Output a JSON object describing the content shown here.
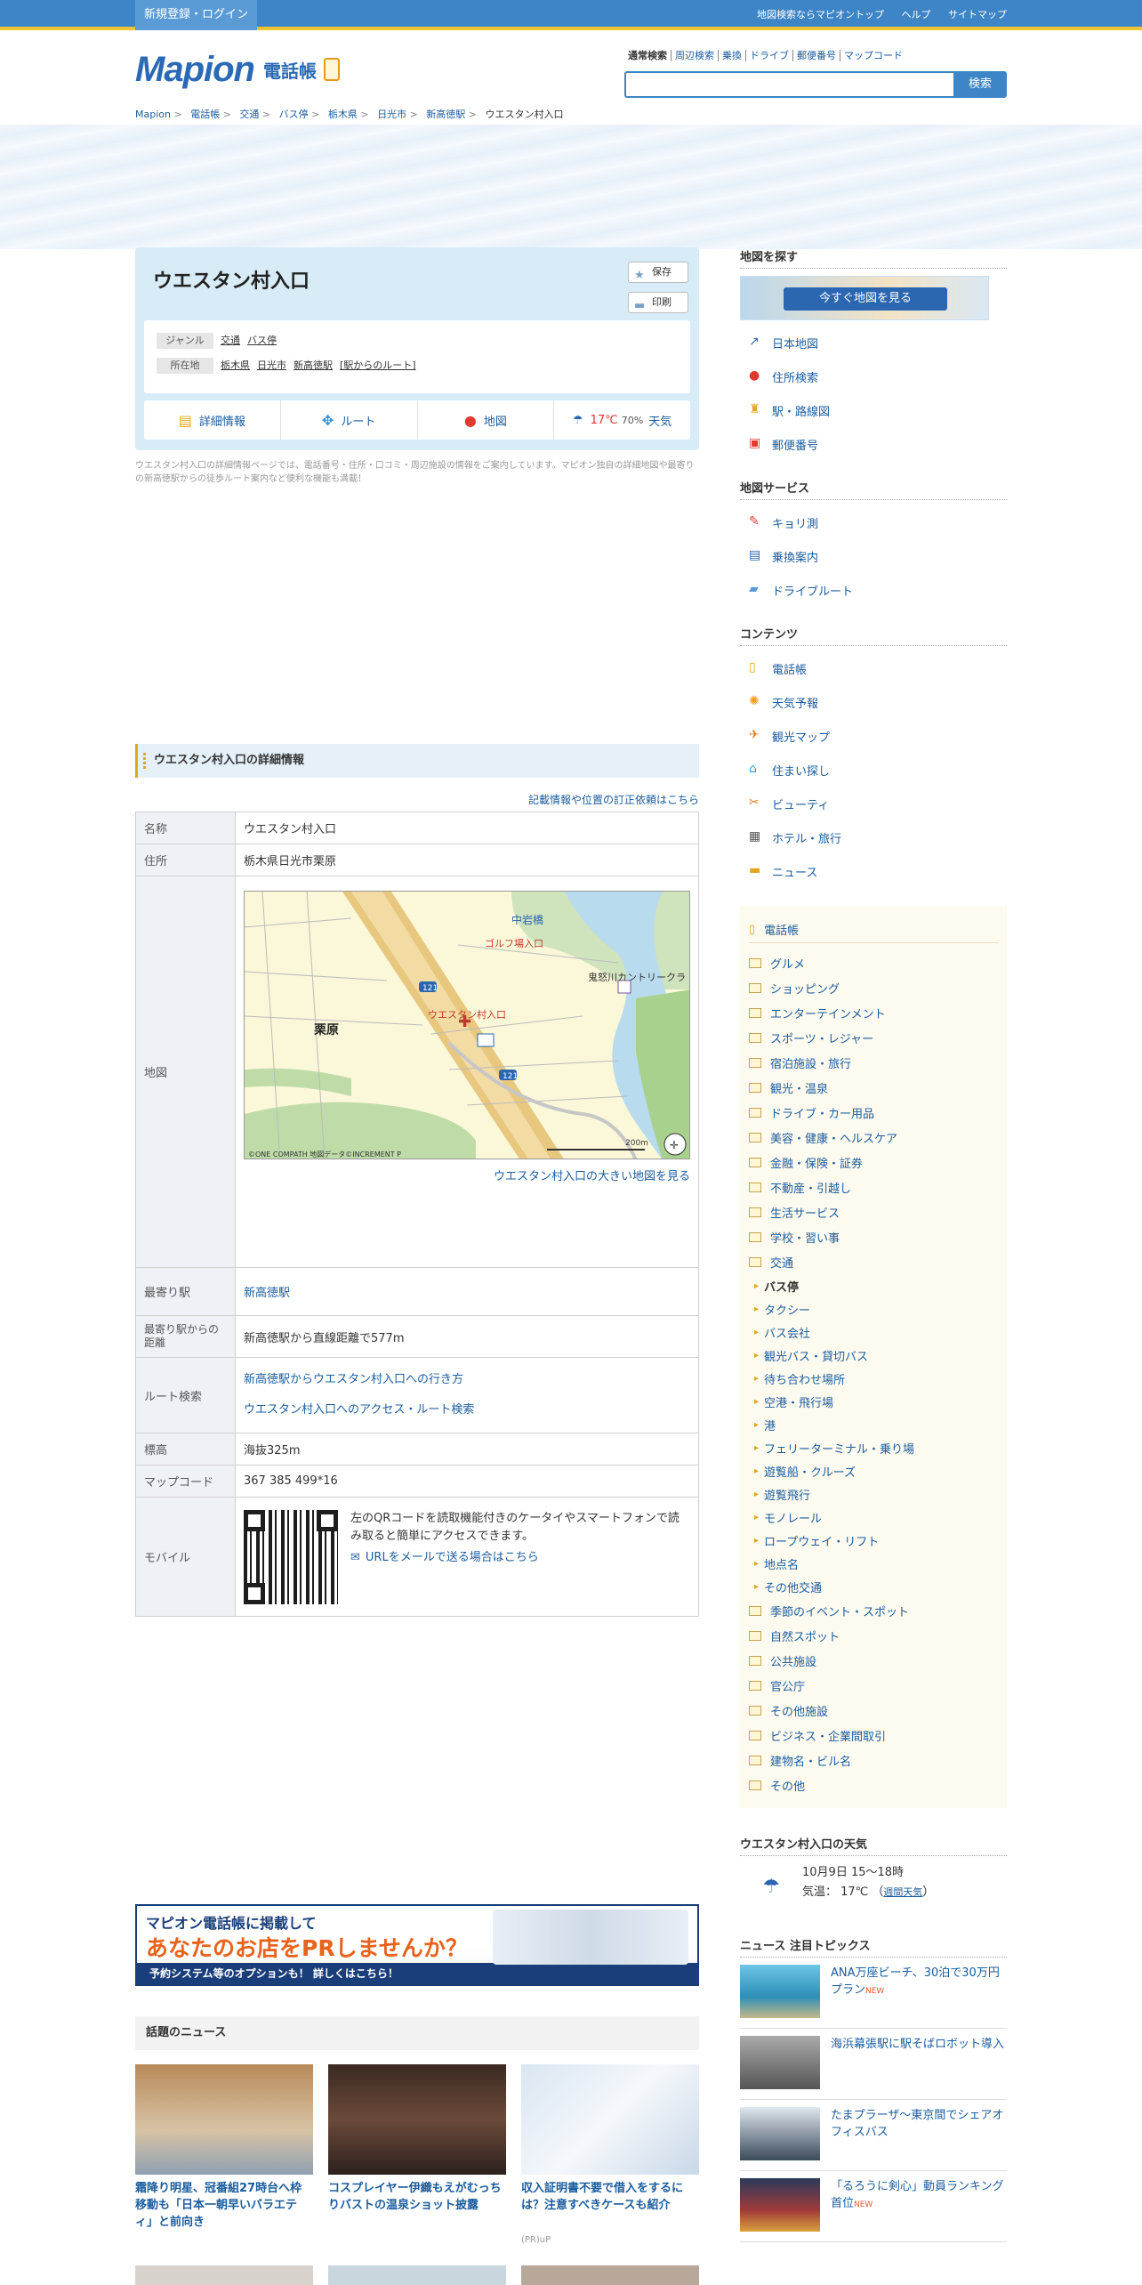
{
  "topbar": {
    "login": "新規登録・ログイン",
    "links": [
      "地図検索ならマピオントップ",
      "ヘルプ",
      "サイトマップ"
    ]
  },
  "logo": {
    "brand": "Mapion",
    "sub": "電話帳"
  },
  "search": {
    "tabs": [
      "通常検索",
      "周辺検索",
      "乗換",
      "ドライブ",
      "郵便番号",
      "マップコード"
    ],
    "button": "検索",
    "value": ""
  },
  "breadcrumb": [
    "Mapion",
    "電話帳",
    "交通",
    "バス停",
    "栃木県",
    "日光市",
    "新高徳駅",
    "ウエスタン村入口"
  ],
  "place": {
    "title": "ウエスタン村入口",
    "save": "保存",
    "print": "印刷",
    "genre_label": "ジャンル",
    "genre": [
      "交通",
      "バス停"
    ],
    "address_label": "所在地",
    "address_links": [
      "栃木県",
      "日光市",
      "新高徳駅",
      "[駅からのルート]"
    ],
    "menu": [
      "詳細情報",
      "ルート",
      "地図",
      "17℃",
      "70%",
      "天気"
    ],
    "description": "ウエスタン村入口の詳細情報ページでは、電話番号・住所・口コミ・周辺施設の情報をご案内しています。マピオン独自の詳細地図や最寄りの新高徳駅からの徒歩ルート案内など便利な機能も満載！"
  },
  "details": {
    "heading": "ウエスタン村入口の詳細情報",
    "correction_link": "記載情報や位置の訂正依頼はこちら",
    "rows": {
      "name_label": "名称",
      "name": "ウエスタン村入口",
      "address_label": "住所",
      "address": "栃木県日光市栗原",
      "map_label": "地図",
      "map_link": "ウエスタン村入口の大きい地図を見る",
      "station_label": "最寄り駅",
      "station": "新高徳駅",
      "distance_label": "最寄り駅からの距離",
      "distance": "新高徳駅から直線距離で577m",
      "route_label": "ルート検索",
      "route_links": [
        "新高徳駅からウエスタン村入口への行き方",
        "ウエスタン村入口へのアクセス・ルート検索"
      ],
      "altitude_label": "標高",
      "altitude": "海抜325m",
      "mapcode_label": "マップコード",
      "mapcode": "367 385 499*16",
      "mobile_label": "モバイル",
      "mobile_text": "左のQRコードを読取機能付きのケータイやスマートフォンで読み取ると簡単にアクセスできます。",
      "mobile_link": "URLをメールで送る場合はこちら"
    },
    "map": {
      "labels": [
        "中岩橋",
        "ゴルフ場入口",
        "鬼怒川カントリークラ",
        "栗原",
        "ウエスタン村入口",
        "121",
        "121"
      ],
      "scale": "200m",
      "copyright": "©ONE COMPATH 地図データ©INCREMENT P"
    }
  },
  "banner": {
    "line1": "マピオン電話帳に掲載して",
    "line2": "あなたのお店をPRしませんか？",
    "line3": "予約システム等のオプションも！ 詳しくはこちら！"
  },
  "news": {
    "heading": "話題のニュース",
    "items": [
      "霜降り明星、冠番組27時台へ枠移動も「日本一朝早いバラエティ」と前向き",
      "コスプレイヤー伊織もえがむっちりバストの温泉ショット披露",
      "収入証明書不要で借入をするには？注意すべきケースも紹介"
    ],
    "pr": "(PR)uP"
  },
  "sidebar": {
    "find_map": "地図を探す",
    "map_button": "今すぐ地図を見る",
    "find_links": [
      "日本地図",
      "住所検索",
      "駅・路線図",
      "郵便番号"
    ],
    "services_head": "地図サービス",
    "services": [
      "キョリ測",
      "乗換案内",
      "ドライブルート"
    ],
    "contents_head": "コンテンツ",
    "contents": [
      "電話帳",
      "天気予報",
      "観光マップ",
      "住まい探し",
      "ビューティ",
      "ホテル・旅行",
      "ニュース"
    ],
    "phonebook_head": "電話帳",
    "categories_top": [
      "グルメ",
      "ショッピング",
      "エンターテインメント",
      "スポーツ・レジャー",
      "宿泊施設・旅行",
      "観光・温泉",
      "ドライブ・カー用品",
      "美容・健康・ヘルスケア",
      "金融・保険・証券",
      "不動産・引越し",
      "生活サービス",
      "学校・習い事",
      "交通"
    ],
    "categories_sub": [
      "バス停",
      "タクシー",
      "バス会社",
      "観光バス・貸切バス",
      "待ち合わせ場所",
      "空港・飛行場",
      "港",
      "フェリーターミナル・乗り場",
      "遊覧船・クルーズ",
      "遊覧飛行",
      "モノレール",
      "ロープウェイ・リフト",
      "地点名",
      "その他交通"
    ],
    "categories_bottom": [
      "季節のイベント・スポット",
      "自然スポット",
      "公共施設",
      "官公庁",
      "その他施設",
      "ビジネス・企業間取引",
      "建物名・ビル名",
      "その他"
    ],
    "weather_head": "ウエスタン村入口の天気",
    "weather_time": "10月9日 15～18時",
    "weather_temp": "気温： 17℃",
    "weather_link": "週間天気",
    "topics_head": "ニュース 注目トピックス",
    "topics": [
      {
        "title": "ANA万座ビーチ、30泊で30万円プラン",
        "new": "NEW"
      },
      {
        "title": "海浜幕張駅に駅そばロボット導入",
        "new": ""
      },
      {
        "title": "たまプラーザ〜東京間でシェアオフィスバス",
        "new": ""
      },
      {
        "title": "「るろうに剣心」動員ランキング首位",
        "new": "NEW"
      }
    ]
  }
}
